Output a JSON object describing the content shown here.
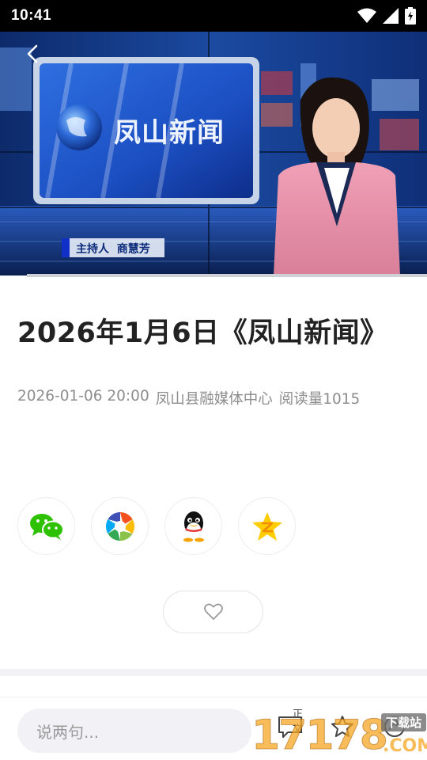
{
  "status_bar": {
    "time": "10:41"
  },
  "video": {
    "banner_text": "凤山新闻",
    "lower_third": "主持人  商慧芳",
    "progress": 1.0
  },
  "article": {
    "title": "2026年1月6日《凤山新闻》",
    "date": "2026-01-06 20:00",
    "source": "凤山县融媒体中心",
    "read_count": "阅读量1015"
  },
  "share": {
    "items": [
      "wechat-icon",
      "moments-icon",
      "qq-icon",
      "qzone-icon"
    ]
  },
  "comment_bar": {
    "placeholder": "说两句...",
    "comment_label": "正文"
  },
  "watermark": {
    "text": "17178",
    "suffix": ".COM",
    "badge": "下载站"
  },
  "colors": {
    "wechat_green": "#2dc100",
    "qzone_yellow": "#ffcc00",
    "meta_gray": "#8d8d8d",
    "title_dark": "#222222"
  }
}
